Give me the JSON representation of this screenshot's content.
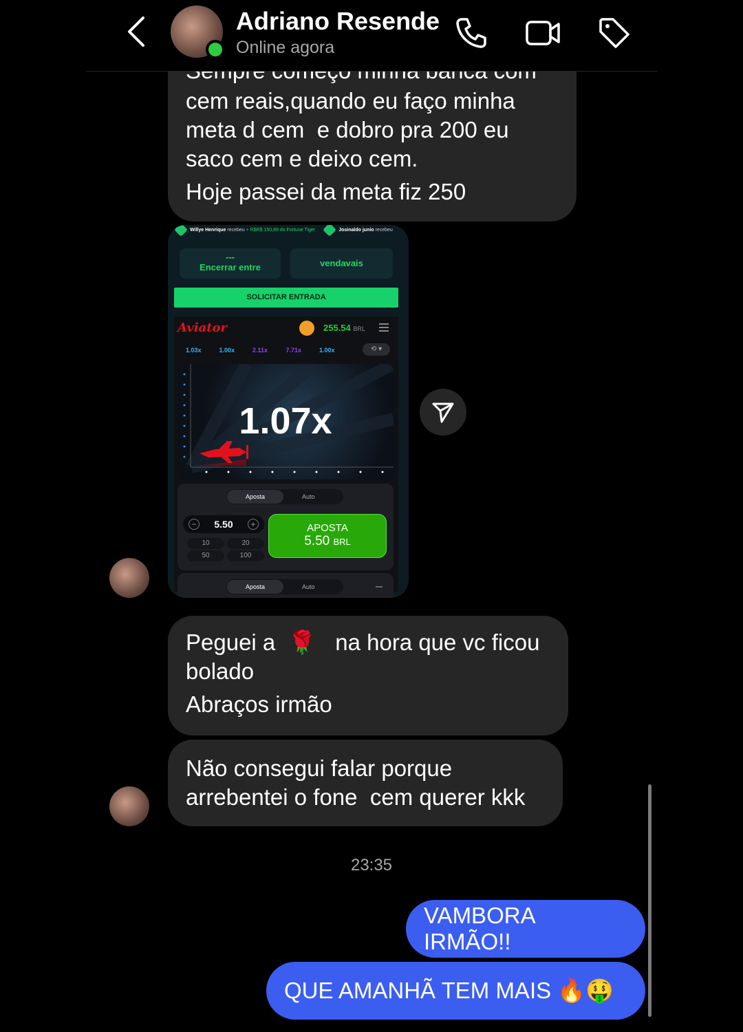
{
  "header": {
    "contact_name": "Adriano Resende",
    "status": "Online agora"
  },
  "messages": {
    "m1": {
      "partial_line": "Sempre começo minha banca com",
      "lines": [
        "cem reais,quando eu faço minha",
        "meta d cem  e dobro pra 200 eu",
        "saco cem e deixo cem.",
        "Hoje passei da meta fiz 250"
      ]
    },
    "m3": {
      "line1_a": "Peguei a",
      "line1_emoji": "🌹",
      "line1_b": "na hora que vc ficou",
      "line2": "bolado",
      "line3": "Abraços irmão"
    },
    "m4": {
      "line1": "Não consegui falar porque",
      "line2": "arrebentei o fone  cem querer kkk"
    },
    "timestamp": "23:35",
    "out1": "VAMBORA IRMÃO!!",
    "out2": "QUE AMANHÃ TEM MAIS 🔥🤑"
  },
  "screenshot": {
    "ticker": {
      "user1": "Willye Henrique",
      "received": "recebeu",
      "amount": "+ R$R$ 150,89 do Fortune Tiger",
      "user2": "Josinaldo junio",
      "received2": "recebeu"
    },
    "btn_left_top": "---",
    "btn_left": "Encerrar entre",
    "btn_right": "vendavais",
    "solicitar": "SOLICITAR ENTRADA",
    "game_logo": "Aviator",
    "balance": "255.54",
    "currency": "BRL",
    "multipliers": [
      {
        "value": "1.03x",
        "color": "#34b4ff"
      },
      {
        "value": "1.00x",
        "color": "#34b4ff"
      },
      {
        "value": "2.11x",
        "color": "#913ef8"
      },
      {
        "value": "7.71x",
        "color": "#913ef8"
      },
      {
        "value": "1.00x",
        "color": "#34b4ff"
      }
    ],
    "current_multiplier": "1.07x",
    "tab_active": "Aposta",
    "tab_inactive": "Auto",
    "bet_value": "5.50",
    "quick_values": [
      "10",
      "20",
      "50",
      "100"
    ],
    "bet_btn_label": "APOSTA",
    "bet_btn_amount": "5.50",
    "bet_btn_currency": "BRL"
  },
  "colors": {
    "incoming_bubble": "#262626",
    "outgoing_bubble": "#3b5ef0",
    "online": "#2ecc40"
  }
}
